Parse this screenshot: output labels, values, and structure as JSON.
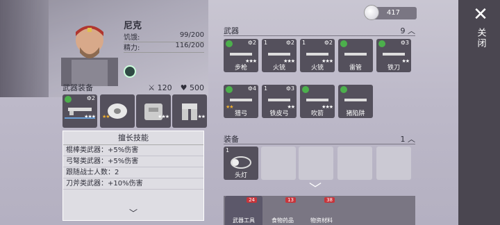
{
  "close": {
    "label": "关闭"
  },
  "currency": {
    "value": "417"
  },
  "character": {
    "name": "尼克",
    "hunger_label": "饥饿:",
    "hunger_value": "99/200",
    "energy_label": "精力:",
    "energy_value": "116/200"
  },
  "weapon_equip": {
    "title": "武器装备",
    "attack": "120",
    "health": "500",
    "slots": [
      {
        "name": "rifle",
        "stars": "★★★",
        "gear": "2"
      },
      {
        "name": "bandage",
        "stars": "★★",
        "gold": true
      },
      {
        "name": "vest",
        "stars": "★★★"
      },
      {
        "name": "pants",
        "stars": "★★"
      }
    ]
  },
  "skills": {
    "title": "擅长技能",
    "rows": [
      "棍棒类武器：+5%伤害",
      "弓弩类武器：+5%伤害",
      "跟随战士人数：2",
      "刀斧类武器：+10%伤害"
    ]
  },
  "weapons": {
    "title": "武器",
    "count": "9",
    "items": [
      {
        "label": "步枪",
        "num": "",
        "gear": "2",
        "stars": "★★★",
        "recycle": true
      },
      {
        "label": "火铳",
        "num": "1",
        "gear": "2",
        "stars": "★★★"
      },
      {
        "label": "火铳",
        "num": "1",
        "gear": "2",
        "stars": "★★★"
      },
      {
        "label": "雷管",
        "num": "",
        "gear": "",
        "stars": "",
        "recycle": true
      },
      {
        "label": "铁刀",
        "num": "",
        "gear": "3",
        "stars": "★★",
        "recycle": true
      },
      {
        "label": "猎弓",
        "num": "",
        "gear": "4",
        "stars": "★★",
        "gold": true,
        "recycle": true
      },
      {
        "label": "铁皮弓",
        "num": "1",
        "gear": "3",
        "stars": "★★"
      },
      {
        "label": "吹箭",
        "num": "",
        "gear": "",
        "stars": "★★★",
        "recycle": true
      },
      {
        "label": "猪陷阱",
        "num": "",
        "gear": "",
        "stars": "",
        "recycle": true
      }
    ]
  },
  "gear": {
    "title": "装备",
    "count": "1",
    "items": [
      {
        "label": "头灯",
        "num": "1"
      }
    ]
  },
  "tabs": [
    {
      "label": "武器工具",
      "count": "24"
    },
    {
      "label": "食物药品",
      "count": "13"
    },
    {
      "label": "物资材料",
      "count": "38"
    }
  ]
}
